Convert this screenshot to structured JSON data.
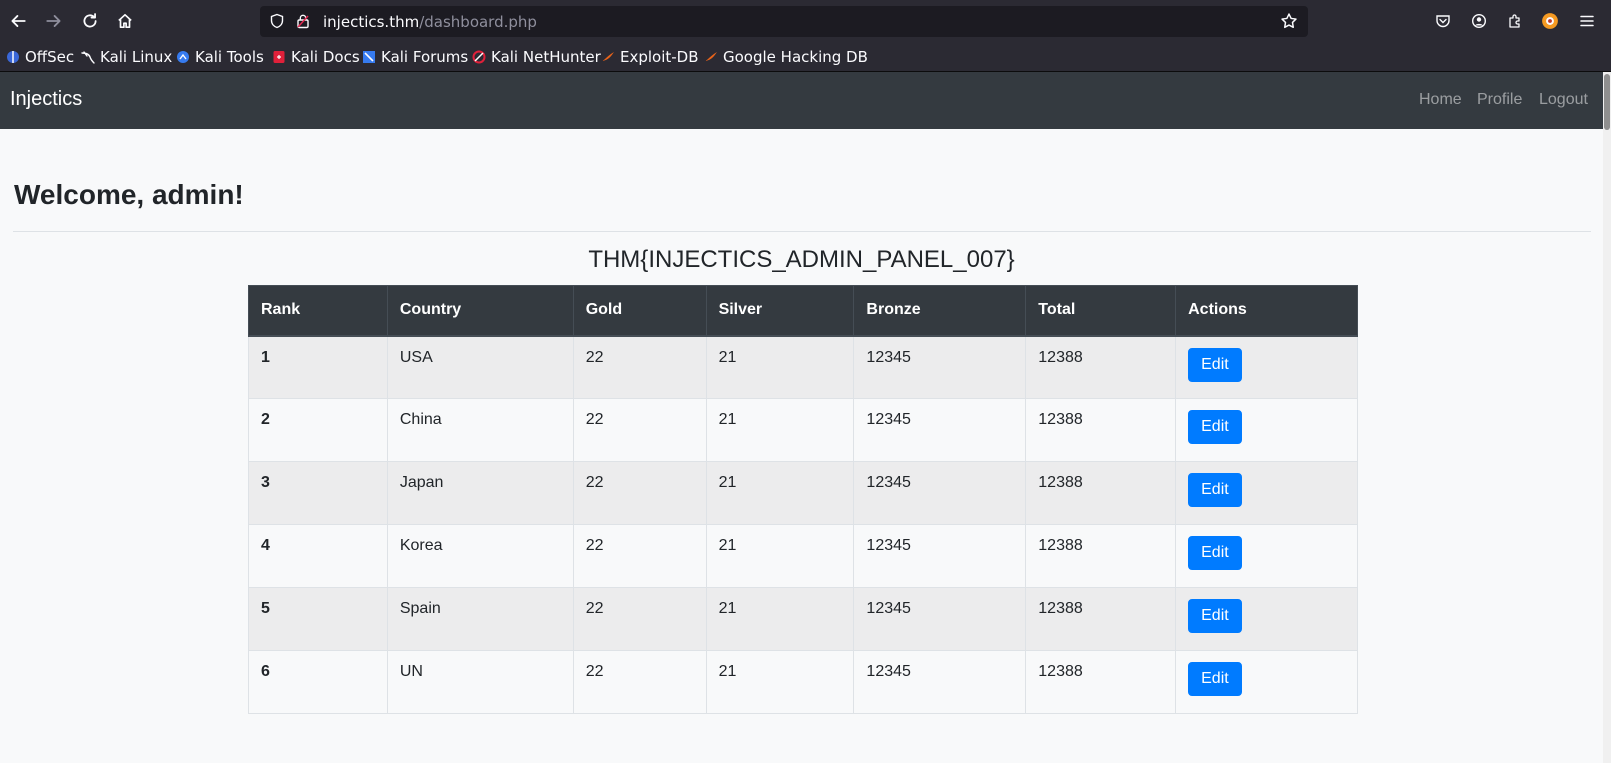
{
  "browser": {
    "url_host": "injectics.thm",
    "url_path": "/dashboard.php",
    "bookmarks": [
      "OffSec",
      "Kali Linux",
      "Kali Tools",
      "Kali Docs",
      "Kali Forums",
      "Kali NetHunter",
      "Exploit-DB",
      "Google Hacking DB"
    ]
  },
  "navbar": {
    "brand": "Injectics",
    "links": [
      "Home",
      "Profile",
      "Logout"
    ]
  },
  "main": {
    "welcome": "Welcome, admin!",
    "flag": "THM{INJECTICS_ADMIN_PANEL_007}",
    "table": {
      "headers": [
        "Rank",
        "Country",
        "Gold",
        "Silver",
        "Bronze",
        "Total",
        "Actions"
      ],
      "rows": [
        {
          "rank": "1",
          "country": "USA",
          "gold": "22",
          "silver": "21",
          "bronze": "12345",
          "total": "12388",
          "action": "Edit"
        },
        {
          "rank": "2",
          "country": "China",
          "gold": "22",
          "silver": "21",
          "bronze": "12345",
          "total": "12388",
          "action": "Edit"
        },
        {
          "rank": "3",
          "country": "Japan",
          "gold": "22",
          "silver": "21",
          "bronze": "12345",
          "total": "12388",
          "action": "Edit"
        },
        {
          "rank": "4",
          "country": "Korea",
          "gold": "22",
          "silver": "21",
          "bronze": "12345",
          "total": "12388",
          "action": "Edit"
        },
        {
          "rank": "5",
          "country": "Spain",
          "gold": "22",
          "silver": "21",
          "bronze": "12345",
          "total": "12388",
          "action": "Edit"
        },
        {
          "rank": "6",
          "country": "UN",
          "gold": "22",
          "silver": "21",
          "bronze": "12345",
          "total": "12388",
          "action": "Edit"
        }
      ]
    }
  },
  "colors": {
    "navbar_bg": "#343a40",
    "button_primary": "#007bff",
    "page_bg": "#f8f9fa"
  }
}
